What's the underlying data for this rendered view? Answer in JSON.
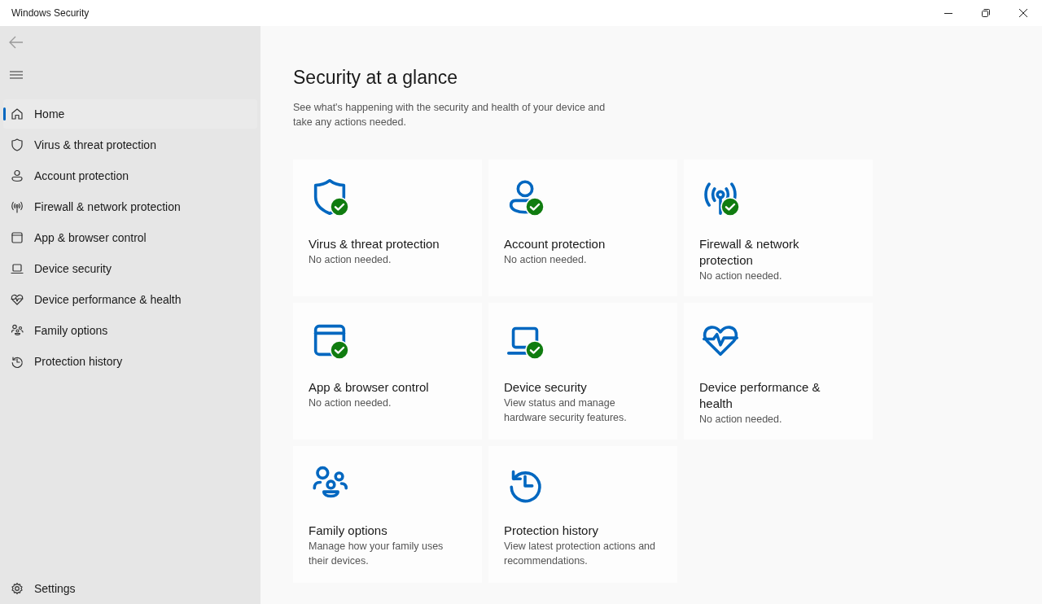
{
  "window": {
    "title": "Windows Security"
  },
  "sidebar": {
    "items": [
      {
        "label": "Home",
        "selected": true
      },
      {
        "label": "Virus & threat protection",
        "selected": false
      },
      {
        "label": "Account protection",
        "selected": false
      },
      {
        "label": "Firewall & network protection",
        "selected": false
      },
      {
        "label": "App & browser control",
        "selected": false
      },
      {
        "label": "Device security",
        "selected": false
      },
      {
        "label": "Device performance & health",
        "selected": false
      },
      {
        "label": "Family options",
        "selected": false
      },
      {
        "label": "Protection history",
        "selected": false
      }
    ],
    "settings": {
      "label": "Settings",
      "selected": false
    }
  },
  "main": {
    "title": "Security at a glance",
    "subtitle": "See what's happening with the security and health of your device and take any actions needed.",
    "tiles": [
      {
        "title": "Virus & threat protection",
        "description": "No action needed.",
        "checked": true
      },
      {
        "title": "Account protection",
        "description": "No action needed.",
        "checked": true
      },
      {
        "title": "Firewall & network protection",
        "description": "No action needed.",
        "checked": true
      },
      {
        "title": "App & browser control",
        "description": "No action needed.",
        "checked": true
      },
      {
        "title": "Device security",
        "description": "View status and manage hardware security features.",
        "checked": true
      },
      {
        "title": "Device performance & health",
        "description": "No action needed.",
        "checked": false
      },
      {
        "title": "Family options",
        "description": "Manage how your family uses their devices.",
        "checked": false
      },
      {
        "title": "Protection history",
        "description": "View latest protection actions and recommendations.",
        "checked": false
      }
    ]
  }
}
